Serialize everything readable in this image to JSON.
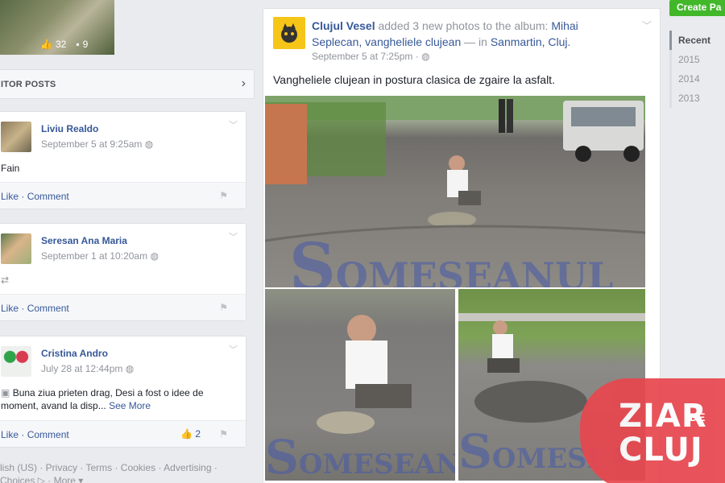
{
  "top_photo": {
    "likes": "32",
    "comments": "9"
  },
  "visitor_posts": {
    "title": "ITOR POSTS",
    "items": [
      {
        "name": "Liviu Realdo",
        "time": "September 5 at 9:25am",
        "text": "Fain",
        "like": "Like",
        "comment": "Comment",
        "likes": ""
      },
      {
        "name": "Seresan Ana Maria",
        "time": "September 1 at 10:20am",
        "text": "",
        "like": "Like",
        "comment": "Comment",
        "likes": ""
      },
      {
        "name": "Cristina Andro",
        "time": "July 28 at 12:44pm",
        "text": "Buna ziua prieten drag, Desi a fost o idee de moment, avand la disp...",
        "see_more": "See More",
        "like": "Like",
        "comment": "Comment",
        "likes": "2"
      }
    ]
  },
  "footer": {
    "line1": "lish (US) · Privacy · Terms · Cookies · Advertising ·",
    "line2": "Choices ▷ · More ▾"
  },
  "main_post": {
    "author": "Clujul Vesel",
    "action": "added 3 new photos to the album:",
    "album": "Mihai Seplecan, vangheliele clujean",
    "location_prefix": "— in",
    "location": "Sanmartin, Cluj.",
    "time": "September 5 at 7:25pm ·",
    "text": "Vangheliele clujean in postura clasica de zgaire la asfalt.",
    "watermark_main": "OMESEANUL",
    "watermark_bl": "OMESEAN",
    "watermark_br": "OMESEA"
  },
  "sidebar": {
    "create_page": "Create Pa",
    "years": [
      "Recent",
      "2015",
      "2014",
      "2013"
    ]
  },
  "logo": {
    "line1": "ZIAR",
    "line2": "CLUJ",
    "de": "DE"
  }
}
